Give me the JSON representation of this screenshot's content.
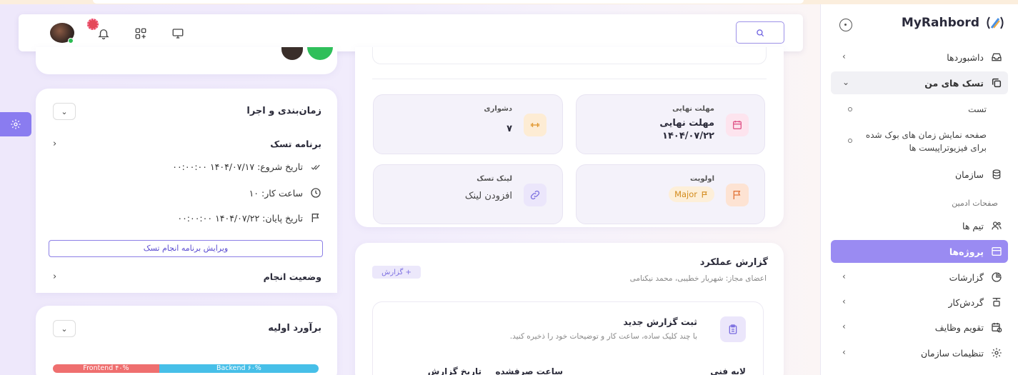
{
  "brand": {
    "name": "MyRahbord"
  },
  "sidebar": {
    "items": [
      {
        "label": "داشبوردها"
      },
      {
        "label": "تسک های من"
      },
      {
        "label": "سازمان"
      },
      {
        "label": "تیم ها"
      },
      {
        "label": "پروژه‌ها"
      },
      {
        "label": "گزارشات"
      },
      {
        "label": "گردش‌کار"
      },
      {
        "label": "تقویم وظایف"
      },
      {
        "label": "تنظیمات سازمان"
      }
    ],
    "subitems": [
      {
        "label": "تست"
      },
      {
        "label": "صفحه نمایش زمان های بوک شده برای فیزیوتراپیست ها"
      }
    ],
    "section_label": "صفحات ادمین"
  },
  "schedule": {
    "title": "زمان‌بندی و اجرا",
    "program_title": "برنامه تسک",
    "start_date": "تاریخ شروع: ۱۴۰۴/۰۷/۱۷ ۰۰:۰۰:۰۰",
    "work_hours": "ساعت کار: ۱۰",
    "end_date": "تاریخ پایان: ۱۴۰۴/۰۷/۲۲ ۰۰:۰۰:۰۰",
    "edit_button": "ویرایش برنامه انجام تسک",
    "status_title": "وضعیت انجام"
  },
  "estimate": {
    "title": "برآورد اولیه",
    "segments": [
      {
        "label": "Frontend ۴۰%",
        "value": 40,
        "color": "#ef6f6f"
      },
      {
        "label": "Backend ۶۰%",
        "value": 60,
        "color": "#47bfe8"
      }
    ]
  },
  "tiles": {
    "deadline_label": "مهلت نهایی",
    "deadline_value_1": "مهلت نهایی",
    "deadline_value_2": "۱۴۰۴/۰۷/۲۲",
    "difficulty_label": "دشواری",
    "difficulty_value": "۷",
    "priority_label": "اولویت",
    "priority_value": "Major",
    "link_label": "لینک تسک",
    "link_value": "افزودن لینک"
  },
  "report": {
    "title": "گزارش عملکرد",
    "members": "اعضای مجاز: شهریار خطیبی، محمد نیکنامی",
    "badge": "+ گزارش",
    "new_title": "ثبت گزارش جدید",
    "new_desc": "با چند کلیک ساده، ساعت کار و توضیحات خود را ذخیره کنید.",
    "col_layer": "لایه فنی",
    "col_hours": "ساعت صرفشده",
    "col_date": "تاریخ گزارش"
  },
  "colors": {
    "accent": "#8a7cf0",
    "active_nav": "#9a8bf2",
    "online": "#2dbb54"
  }
}
